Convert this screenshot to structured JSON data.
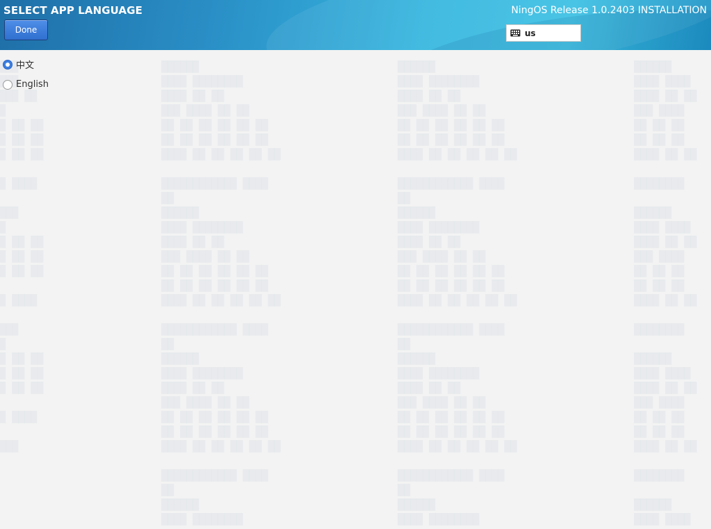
{
  "header": {
    "page_title": "SELECT APP LANGUAGE",
    "done_label": "Done",
    "product_title": "NingOS Release 1.0.2403 INSTALLATION",
    "keyboard_layout": "us"
  },
  "languages": [
    {
      "label": "中文",
      "selected": true
    },
    {
      "label": "English",
      "selected": false
    }
  ],
  "colors": {
    "accent": "#3d7ee0",
    "header_gradient_start": "#1f6fa8",
    "header_gradient_end": "#3cc0e3",
    "background": "#f3f3f3"
  },
  "icons": {
    "keyboard": "keyboard-icon"
  }
}
